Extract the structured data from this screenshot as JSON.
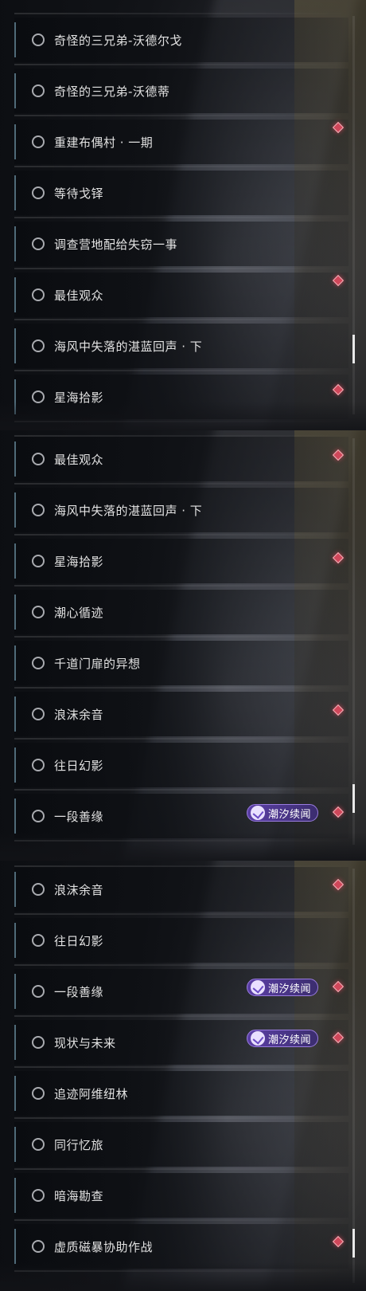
{
  "panels": [
    {
      "items": [
        {
          "label": "奇怪的三兄弟-沃德尔戈"
        },
        {
          "label": "奇怪的三兄弟-沃德蒂"
        },
        {
          "label": "重建布偶村 · 一期"
        },
        {
          "label": "等待戈铎"
        },
        {
          "label": "调查营地配给失窃一事"
        },
        {
          "label": "最佳观众"
        },
        {
          "label": "海风中失落的湛蓝回声 · 下"
        },
        {
          "label": "星海拾影"
        }
      ]
    },
    {
      "items": [
        {
          "label": "最佳观众"
        },
        {
          "label": "海风中失落的湛蓝回声 · 下"
        },
        {
          "label": "星海拾影"
        },
        {
          "label": "潮心循迹"
        },
        {
          "label": "千道门扉的异想"
        },
        {
          "label": "浪沫余音"
        },
        {
          "label": "往日幻影"
        },
        {
          "label": "一段善缘"
        }
      ],
      "tag_label": "潮汐续闻"
    },
    {
      "items": [
        {
          "label": "浪沫余音"
        },
        {
          "label": "往日幻影"
        },
        {
          "label": "一段善缘"
        },
        {
          "label": "现状与未来"
        },
        {
          "label": "追迹阿维纽林"
        },
        {
          "label": "同行忆旅"
        },
        {
          "label": "暗海勘查"
        },
        {
          "label": "虚质磁暴协助作战"
        }
      ],
      "tag_label": "潮汐续闻"
    }
  ],
  "colors": {
    "accent_diamond": "#d0475a",
    "tag_purple": "#5b3fa6",
    "left_bar": "#4f6a78"
  },
  "icons": {
    "status": "empty-circle-icon",
    "marker": "red-diamond-icon",
    "tag": "tide-swirl-icon"
  }
}
